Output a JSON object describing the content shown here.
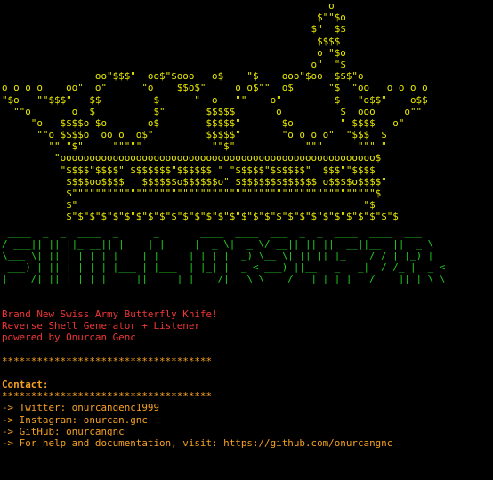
{
  "theme": {
    "background": "#000000",
    "crown_color": "#e8e800",
    "banner_color": "#20d020",
    "tagline_color": "#f03535",
    "separator_color": "#f4a020",
    "contact_color": "#f4a020"
  },
  "crown": [
    "                                                        o",
    "                                                      $\"\"$o",
    "                                                     $\"  $$",
    "                                                      $$$$",
    "                                                      o \"$o",
    "                                                     o\"  \"$",
    "                oo\"$$$\"  oo$\"$ooo   o$    \"$    ooo\"$oo  $$$\"o",
    "o o o o    oo\"  o\"      \"o    $$o$\"     o o$\"\"  o$      \"$  \"oo   o o o o",
    "\"$o   \"\"$$$\"   $$         $      \"  o   \"\"    o\"         $   \"o$$\"    o$$",
    "  \"\"o       o  $          $\"       $$$$$       o          $  ooo     o\"\"",
    "     \"o   $$$$o $o       o$        $$$$$\"       $o        \" $$$$   o\"",
    "      \"\"o $$$$o  oo o  o$\"         $$$$$\"       \"o o o o\"  \"$$$  $",
    "        \"\" \"$\"     \"\"\"\"\"            \"\"$\"            \"\"\"      \"\"\" \"",
    "         \"oooooooooooooooooooooooooooooooooooooooooooooooooooooo$",
    "          \"$$$$\"$$$$\" $$$$$$$\"$$$$$$ \" \"$$$$$\"$$$$$$\"  $$$\"\"$$$$",
    "           $$$$oo$$$$   $$$$$$o$$$$$$o\" $$$$$$$$$$$$$$ o$$$$o$$$$\"",
    "           $\"\"\"\"\"\"\"\"\"\"\"\"\"\"\"\"\"\"\"\"\"\"\"\"\"\"\"\"\"\"\"\"\"\"\"\"\"\"\"\"\"\"\"\"\"\"\"\"\"\"\"\"$",
    "           $\"                                                 \"$",
    "           $\"$\"$\"$\"$\"$\"$\"$\"$\"$\"$\"$\"$\"$\"$\"$\"$\"$\"$\"$\"$\"$\"$\"$\"$\"$\"$\"$\"$"
  ],
  "banner": [
    " ____  _  _  ____  _      _       ____  ____  ___  _  _  ____  ____  ___ ",
    "/ ___|| || ||_ __|| |    | |     |  _ \\|  _ \\/ __|| || ||  __||__  ||  _ \\",
    "\\___ \\| || | | | | |    | |     | | | | |_) \\__ \\| || || |_    / / | |_) |",
    " ___) | || | | | | |___ | |___  | |_| |  _ < ___) ||__   _|  _|  / /_ |  _ <",
    "|____/|_||_| |_| |_____||_____| |____/|_| \\_\\____/   |_| |_|   /____||_| \\_\\"
  ],
  "tagline": [
    "Brand New Swiss Army Butterfly Knife!",
    "Reverse Shell Generator + Listener",
    "powered by Onurcan Genc"
  ],
  "separator": "************************************",
  "contact": {
    "title": "Contact:",
    "separator": "************************************",
    "items": [
      "-> Twitter: onurcangenc1999",
      "-> Instagram: onurcan.gnc",
      "-> GitHub: onurcangnc",
      "-> For help and documentation, visit: https://github.com/onurcangnc"
    ]
  }
}
